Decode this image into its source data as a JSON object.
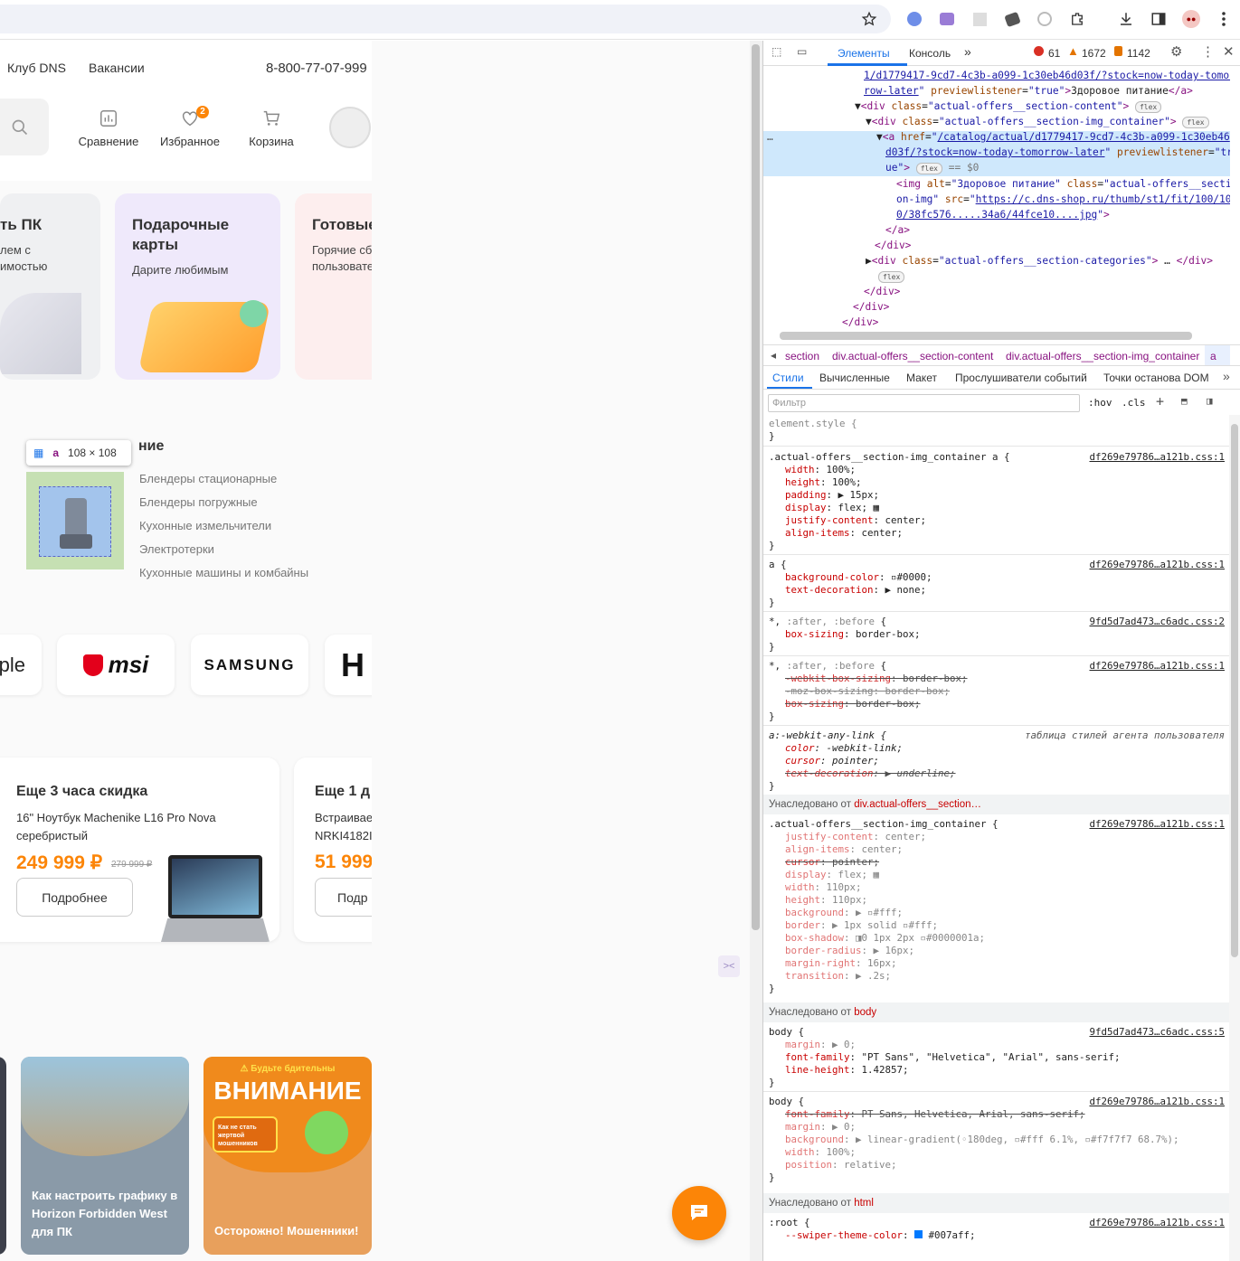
{
  "site": {
    "topnav": {
      "club": "Клуб DNS",
      "vacancies": "Вакансии",
      "phone": "8-800-77-07-999"
    },
    "header": {
      "compare": "Сравнение",
      "favorites": "Избранное",
      "fav_count": "2",
      "cart": "Корзина"
    },
    "promo_cards": [
      {
        "title": "ть ПК",
        "text": "лем с\nимостью"
      },
      {
        "title": "Подарочные\nкарты",
        "text": "Дарите любимым"
      },
      {
        "title": "Готовые",
        "text": "Горячие сб\nпользовате"
      }
    ],
    "section_title": "ние",
    "tooltip": {
      "tag": "a",
      "size": "108 × 108"
    },
    "categories": [
      "Блендеры стационарные",
      "Блендеры погружные",
      "Кухонные измельчители",
      "Электротерки",
      "Кухонные машины и комбайны"
    ],
    "brands": [
      "ple",
      "msi",
      "SAMSUNG",
      "H"
    ],
    "deals": [
      {
        "timer": "Еще 3 часа скидка",
        "name": "16\" Ноутбук Machenike L16 Pro Nova серебристый",
        "price": "249 999 ₽",
        "old_price": "279 999 ₽",
        "button": "Подробнее"
      },
      {
        "timer": "Еще 1 д",
        "name": "Встраивае\nNRKI4182I",
        "price": "51 999",
        "button": "Подр"
      }
    ],
    "news": [
      {
        "caption": "Как настроить графику в Horizon Forbidden West для ПК"
      },
      {
        "banner_top": "⚠ Будьте бдительны",
        "banner_title": "ВНИМАНИЕ",
        "banner_inner": "Как не стать жертвой мошенников",
        "caption": "Осторожно! Мошенники!"
      }
    ]
  },
  "devtools": {
    "tabs": {
      "elements": "Элементы",
      "console": "Консоль",
      "errors": "61",
      "warnings": "1672",
      "info": "1142"
    },
    "breadcrumbs": [
      "section",
      "div.actual-offers__section-content",
      "div.actual-offers__section-img_container",
      "a"
    ],
    "style_tabs": [
      "Стили",
      "Вычисленные",
      "Макет",
      "Прослушиватели событий",
      "Точки останова DOM"
    ],
    "filter_placeholder": "Фильтр",
    "hov": ":hov",
    "cls": ".cls",
    "inherited": {
      "label": "Унаследовано от",
      "section": "div.actual-offers__section…",
      "body": "body",
      "html": "html"
    },
    "ua_stylesheet": "таблица стилей агента пользователя"
  },
  "colors": {
    "accent": "#fc8507",
    "devtools_blue": "#1a73e8"
  }
}
